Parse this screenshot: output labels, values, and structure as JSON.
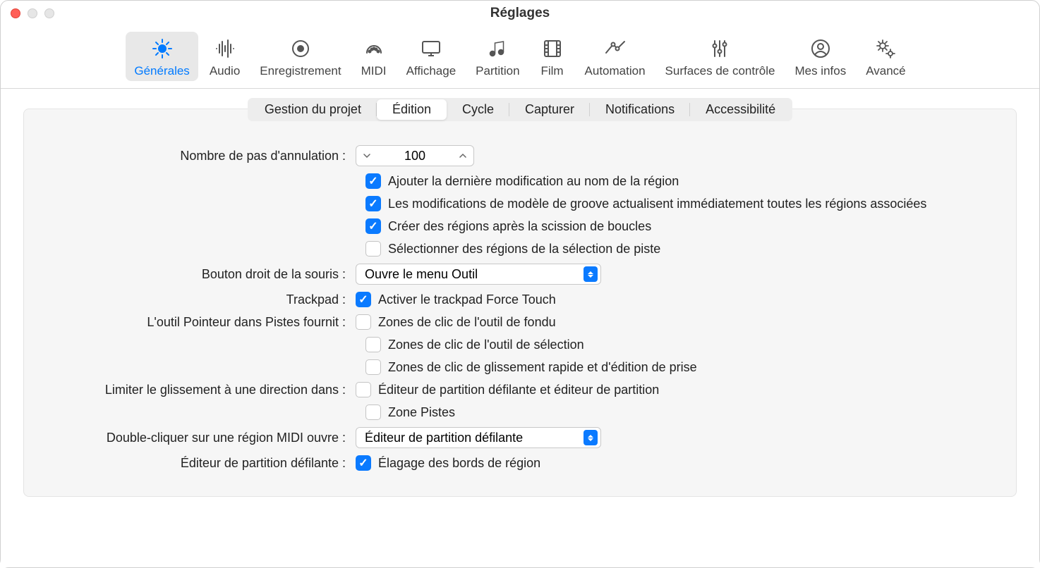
{
  "window": {
    "title": "Réglages"
  },
  "toolbar": {
    "items": [
      {
        "label": "Générales"
      },
      {
        "label": "Audio"
      },
      {
        "label": "Enregistrement"
      },
      {
        "label": "MIDI"
      },
      {
        "label": "Affichage"
      },
      {
        "label": "Partition"
      },
      {
        "label": "Film"
      },
      {
        "label": "Automation"
      },
      {
        "label": "Surfaces de contrôle"
      },
      {
        "label": "Mes infos"
      },
      {
        "label": "Avancé"
      }
    ]
  },
  "subtabs": {
    "items": [
      {
        "label": "Gestion du projet"
      },
      {
        "label": "Édition"
      },
      {
        "label": "Cycle"
      },
      {
        "label": "Capturer"
      },
      {
        "label": "Notifications"
      },
      {
        "label": "Accessibilité"
      }
    ]
  },
  "form": {
    "undo_steps_label": "Nombre de pas d'annulation :",
    "undo_steps_value": "100",
    "cb_add_last": "Ajouter la dernière modification au nom de la région",
    "cb_groove": "Les modifications de modèle de groove actualisent immédiatement toutes les régions associées",
    "cb_create_regions": "Créer des régions après la scission de boucles",
    "cb_select_regions": "Sélectionner des régions de la sélection de piste",
    "right_mouse_label": "Bouton droit de la souris :",
    "right_mouse_value": "Ouvre le menu Outil",
    "trackpad_label": "Trackpad :",
    "cb_force_touch": "Activer le trackpad Force Touch",
    "pointer_tool_label": "L'outil Pointeur dans Pistes fournit :",
    "cb_fade": "Zones de clic de l'outil de fondu",
    "cb_selection": "Zones de clic de l'outil de sélection",
    "cb_quick_swipe": "Zones de clic de glissement rapide et d'édition de prise",
    "limit_drag_label": "Limiter le glissement à une direction dans :",
    "cb_piano_score": "Éditeur de partition défilante et éditeur de partition",
    "cb_tracks_area": "Zone Pistes",
    "double_click_label": "Double-cliquer sur une région MIDI ouvre :",
    "double_click_value": "Éditeur de partition défilante",
    "piano_roll_label": "Éditeur de partition défilante :",
    "cb_clip_edges": "Élagage des bords de région"
  }
}
